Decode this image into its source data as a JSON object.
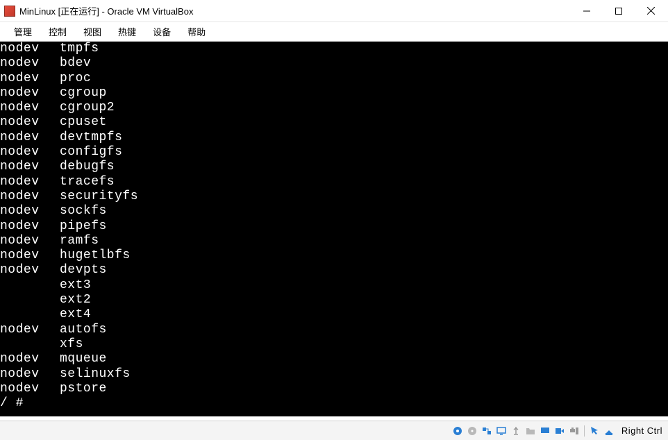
{
  "window": {
    "title": "MinLinux [正在运行] - Oracle VM VirtualBox"
  },
  "menubar": {
    "items": [
      {
        "label": "管理"
      },
      {
        "label": "控制"
      },
      {
        "label": "视图"
      },
      {
        "label": "热键"
      },
      {
        "label": "设备"
      },
      {
        "label": "帮助"
      }
    ]
  },
  "terminal": {
    "rows": [
      {
        "c1": "nodev",
        "c2": "tmpfs"
      },
      {
        "c1": "nodev",
        "c2": "bdev"
      },
      {
        "c1": "nodev",
        "c2": "proc"
      },
      {
        "c1": "nodev",
        "c2": "cgroup"
      },
      {
        "c1": "nodev",
        "c2": "cgroup2"
      },
      {
        "c1": "nodev",
        "c2": "cpuset"
      },
      {
        "c1": "nodev",
        "c2": "devtmpfs"
      },
      {
        "c1": "nodev",
        "c2": "configfs"
      },
      {
        "c1": "nodev",
        "c2": "debugfs"
      },
      {
        "c1": "nodev",
        "c2": "tracefs"
      },
      {
        "c1": "nodev",
        "c2": "securityfs"
      },
      {
        "c1": "nodev",
        "c2": "sockfs"
      },
      {
        "c1": "nodev",
        "c2": "pipefs"
      },
      {
        "c1": "nodev",
        "c2": "ramfs"
      },
      {
        "c1": "nodev",
        "c2": "hugetlbfs"
      },
      {
        "c1": "nodev",
        "c2": "devpts"
      },
      {
        "c1": "",
        "c2": "ext3"
      },
      {
        "c1": "",
        "c2": "ext2"
      },
      {
        "c1": "",
        "c2": "ext4"
      },
      {
        "c1": "nodev",
        "c2": "autofs"
      },
      {
        "c1": "",
        "c2": "xfs"
      },
      {
        "c1": "nodev",
        "c2": "mqueue"
      },
      {
        "c1": "nodev",
        "c2": "selinuxfs"
      },
      {
        "c1": "nodev",
        "c2": "pstore"
      }
    ],
    "prompt": "/ # "
  },
  "statusbar": {
    "host_key": "Right Ctrl",
    "icons": [
      "hard-disk-icon",
      "optical-disc-icon",
      "network-icon",
      "display-icon",
      "usb-icon",
      "shared-folder-icon",
      "audio-icon",
      "recording-icon",
      "clipboard-icon",
      "mouse-integration-icon",
      "keyboard-icon"
    ]
  }
}
